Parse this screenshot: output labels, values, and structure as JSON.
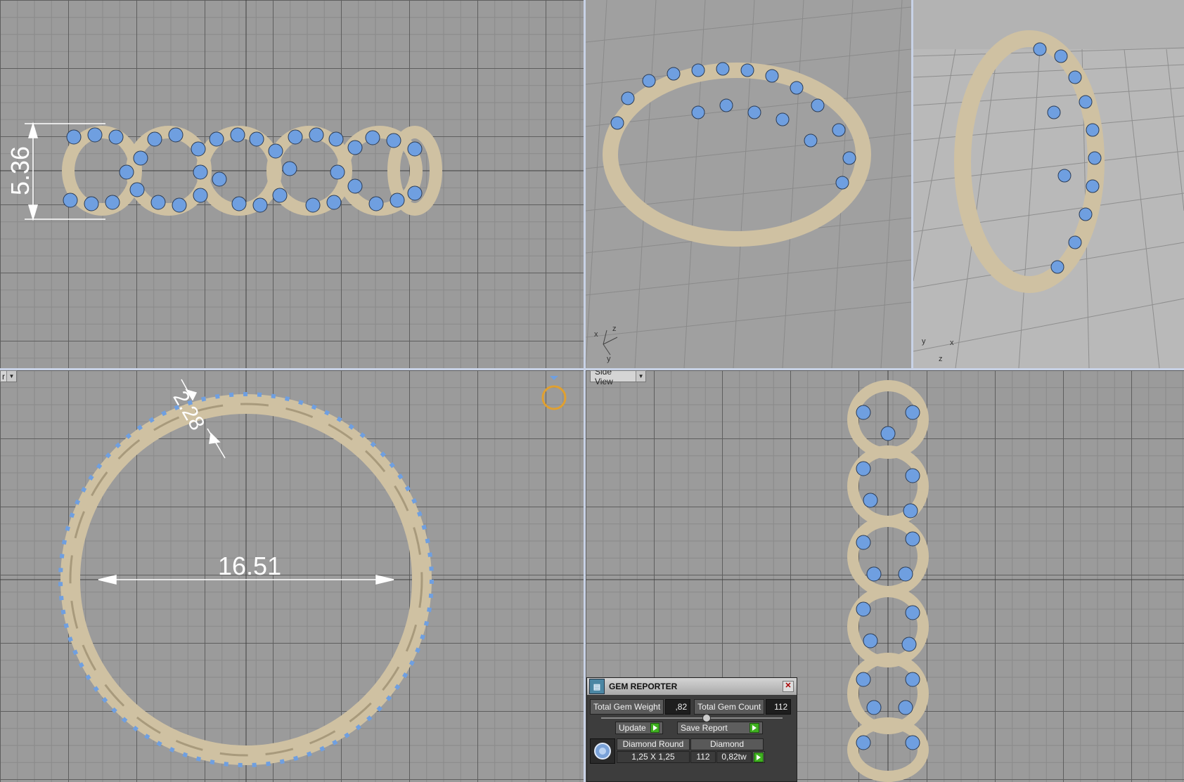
{
  "viewports": {
    "front": {
      "label": "",
      "dimension": "5.36"
    },
    "persp1": {
      "axis_labels": [
        "x",
        "z",
        "y"
      ]
    },
    "persp2": {
      "axis_labels": [
        "y",
        "x",
        "z"
      ]
    },
    "top": {
      "label": "r",
      "dimension_inner": "16.51",
      "dimension_band": "2.28"
    },
    "side": {
      "label": "Side View"
    }
  },
  "gem_reporter": {
    "title": "GEM REPORTER",
    "total_weight_label": "Total Gem Weight",
    "total_weight_value": ",82",
    "total_count_label": "Total Gem Count",
    "total_count_value": "112",
    "update_label": "Update",
    "save_report_label": "Save Report",
    "row": {
      "shape": "Diamond Round",
      "material": "Diamond",
      "size": "1,25 X 1,25",
      "count": "112",
      "weight": "0,82tw"
    }
  },
  "colors": {
    "metal": "#d4c6a8",
    "gem": "#6f9fe0",
    "separator": "#c8d2e6",
    "accent_ring": "#e0a030"
  }
}
